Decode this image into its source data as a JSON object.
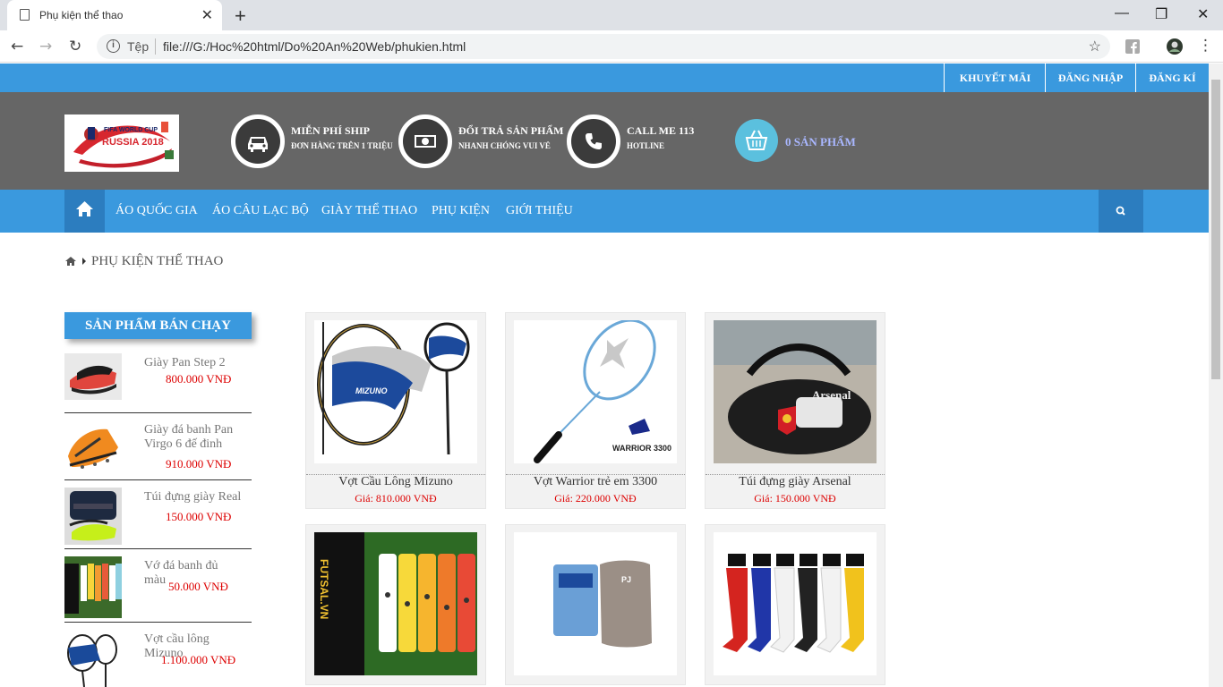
{
  "browser": {
    "tab_title": "Phụ kiện thể thao",
    "new_tab": "+",
    "address_label": "Tệp",
    "url": "file:///G:/Hoc%20html/Do%20An%20Web/phukien.html",
    "window_min": "—",
    "window_max": "❐",
    "window_close": "✕",
    "tab_close": "✕"
  },
  "topbar": {
    "links": [
      "KHUYẾT MÃI",
      "ĐĂNG NHẬP",
      "ĐĂNG KÍ"
    ]
  },
  "header": {
    "features": [
      {
        "title": "MIỄN PHÍ SHIP",
        "subtitle": "ĐƠN HÀNG TRÊN 1 TRIỆU",
        "icon": "car-icon"
      },
      {
        "title": "ĐỔI TRẢ SẢN PHẨM",
        "subtitle": "NHANH CHÓNG VUI VẺ",
        "icon": "money-icon"
      },
      {
        "title": "CALL ME 113",
        "subtitle": "HOTLINE",
        "icon": "phone-icon"
      }
    ],
    "cart_text": "0 SẢN PHẨM",
    "logo_text_1": "FIFA WORLD CUP",
    "logo_text_2": "RUSSIA 2018"
  },
  "nav": {
    "items": [
      "ÁO QUỐC GIA",
      "ÁO CÂU LẠC BỘ",
      "GIÀY THỂ THAO",
      "PHỤ KIỆN",
      "GIỚI THIỆU"
    ]
  },
  "breadcrumb": {
    "current": "PHỤ KIỆN THỂ THAO"
  },
  "sidebar": {
    "heading": "SẢN PHẨM BÁN CHẠY",
    "items": [
      {
        "name": "Giày Pan Step 2",
        "price": "800.000 VNĐ"
      },
      {
        "name": "Giày đá banh Pan Virgo 6 đế đinh",
        "price": "910.000 VNĐ"
      },
      {
        "name": "Túi đựng giày Real",
        "price": "150.000 VNĐ"
      },
      {
        "name": "Vớ đá banh đủ màu",
        "price": "50.000 VNĐ"
      },
      {
        "name": "Vợt cầu lông Mizuno",
        "price": "1.100.000 VNĐ"
      }
    ]
  },
  "products": [
    {
      "name": "Vợt Cầu Lông Mizuno",
      "price": "Giá: 810.000 VNĐ"
    },
    {
      "name": "Vợt Warrior trẻ em 3300",
      "price": "Giá: 220.000 VNĐ"
    },
    {
      "name": "Túi đựng giày Arsenal",
      "price": "Giá: 150.000 VNĐ"
    }
  ],
  "product_labels": {
    "mizuno": "MIZUNO",
    "warrior": "WARRIOR 3300",
    "arsenal": "Arsenal",
    "futsal": "FUTSAL.VN",
    "pj": "PJ"
  }
}
